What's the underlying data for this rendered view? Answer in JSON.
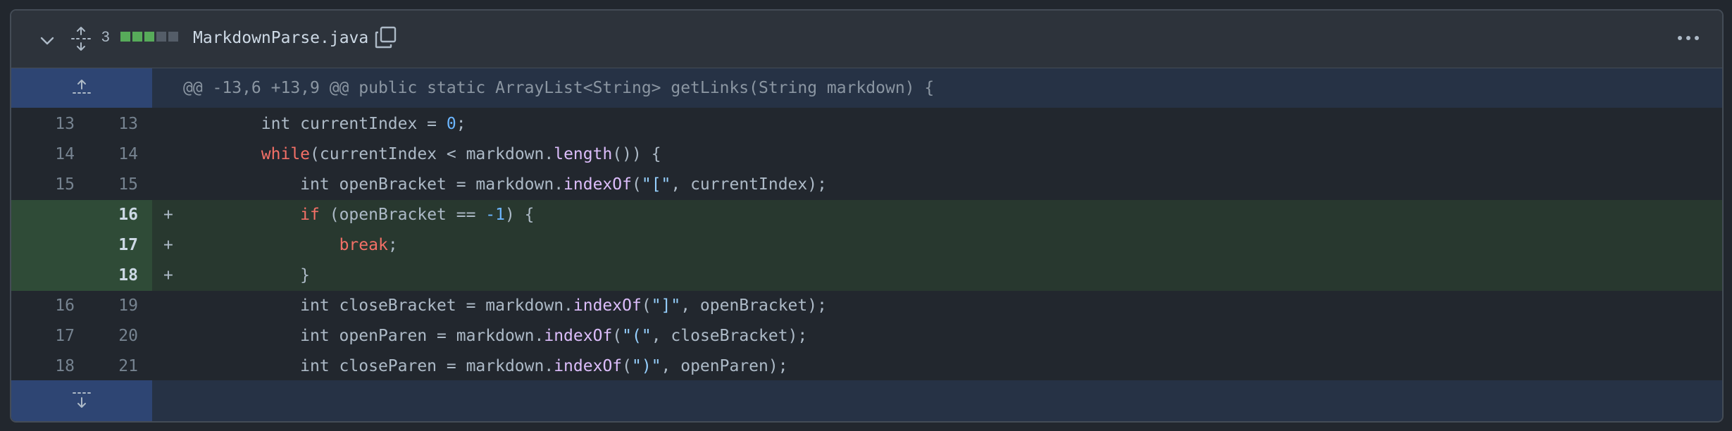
{
  "file": {
    "changes_count": "3",
    "diffstat": {
      "added": 3,
      "deleted": 0,
      "neutral": 2
    },
    "name": "MarkdownParse.java",
    "colors": {
      "added": "#57ab5a",
      "neutral": "#545d68"
    }
  },
  "hunk": {
    "header": "@@ -13,6 +13,9 @@ public static ArrayList<String> getLinks(String markdown) {"
  },
  "icons": {
    "collapse": "chevron-down-icon",
    "expand_all": "fold-icon",
    "copy": "copy-icon",
    "more": "kebab-horizontal-icon",
    "expand_up": "expand-up-icon",
    "expand_down": "expand-down-icon"
  },
  "lines": [
    {
      "old": "13",
      "new": "13",
      "sign": "",
      "type": "context",
      "tokens": [
        {
          "t": "        int currentIndex = ",
          "c": ""
        },
        {
          "t": "0",
          "c": "num"
        },
        {
          "t": ";",
          "c": ""
        }
      ]
    },
    {
      "old": "14",
      "new": "14",
      "sign": "",
      "type": "context",
      "tokens": [
        {
          "t": "        ",
          "c": ""
        },
        {
          "t": "while",
          "c": "kw"
        },
        {
          "t": "(currentIndex < markdown.",
          "c": ""
        },
        {
          "t": "length",
          "c": "fn"
        },
        {
          "t": "()) {",
          "c": ""
        }
      ]
    },
    {
      "old": "15",
      "new": "15",
      "sign": "",
      "type": "context",
      "tokens": [
        {
          "t": "            int openBracket = markdown.",
          "c": ""
        },
        {
          "t": "indexOf",
          "c": "fn"
        },
        {
          "t": "(",
          "c": ""
        },
        {
          "t": "\"[\"",
          "c": "str"
        },
        {
          "t": ", currentIndex);",
          "c": ""
        }
      ]
    },
    {
      "old": "",
      "new": "16",
      "sign": "+",
      "type": "add",
      "tokens": [
        {
          "t": "            ",
          "c": ""
        },
        {
          "t": "if",
          "c": "kw"
        },
        {
          "t": " (openBracket == ",
          "c": ""
        },
        {
          "t": "-1",
          "c": "num"
        },
        {
          "t": ") {",
          "c": ""
        }
      ]
    },
    {
      "old": "",
      "new": "17",
      "sign": "+",
      "type": "add",
      "tokens": [
        {
          "t": "                ",
          "c": ""
        },
        {
          "t": "break",
          "c": "kw"
        },
        {
          "t": ";",
          "c": ""
        }
      ]
    },
    {
      "old": "",
      "new": "18",
      "sign": "+",
      "type": "add",
      "tokens": [
        {
          "t": "            }",
          "c": ""
        }
      ]
    },
    {
      "old": "16",
      "new": "19",
      "sign": "",
      "type": "context",
      "tokens": [
        {
          "t": "            int closeBracket = markdown.",
          "c": ""
        },
        {
          "t": "indexOf",
          "c": "fn"
        },
        {
          "t": "(",
          "c": ""
        },
        {
          "t": "\"]\"",
          "c": "str"
        },
        {
          "t": ", openBracket);",
          "c": ""
        }
      ]
    },
    {
      "old": "17",
      "new": "20",
      "sign": "",
      "type": "context",
      "tokens": [
        {
          "t": "            int openParen = markdown.",
          "c": ""
        },
        {
          "t": "indexOf",
          "c": "fn"
        },
        {
          "t": "(",
          "c": ""
        },
        {
          "t": "\"(\"",
          "c": "str"
        },
        {
          "t": ", closeBracket);",
          "c": ""
        }
      ]
    },
    {
      "old": "18",
      "new": "21",
      "sign": "",
      "type": "context",
      "tokens": [
        {
          "t": "            int closeParen = markdown.",
          "c": ""
        },
        {
          "t": "indexOf",
          "c": "fn"
        },
        {
          "t": "(",
          "c": ""
        },
        {
          "t": "\")\"",
          "c": "str"
        },
        {
          "t": ", openParen);",
          "c": ""
        }
      ]
    }
  ]
}
